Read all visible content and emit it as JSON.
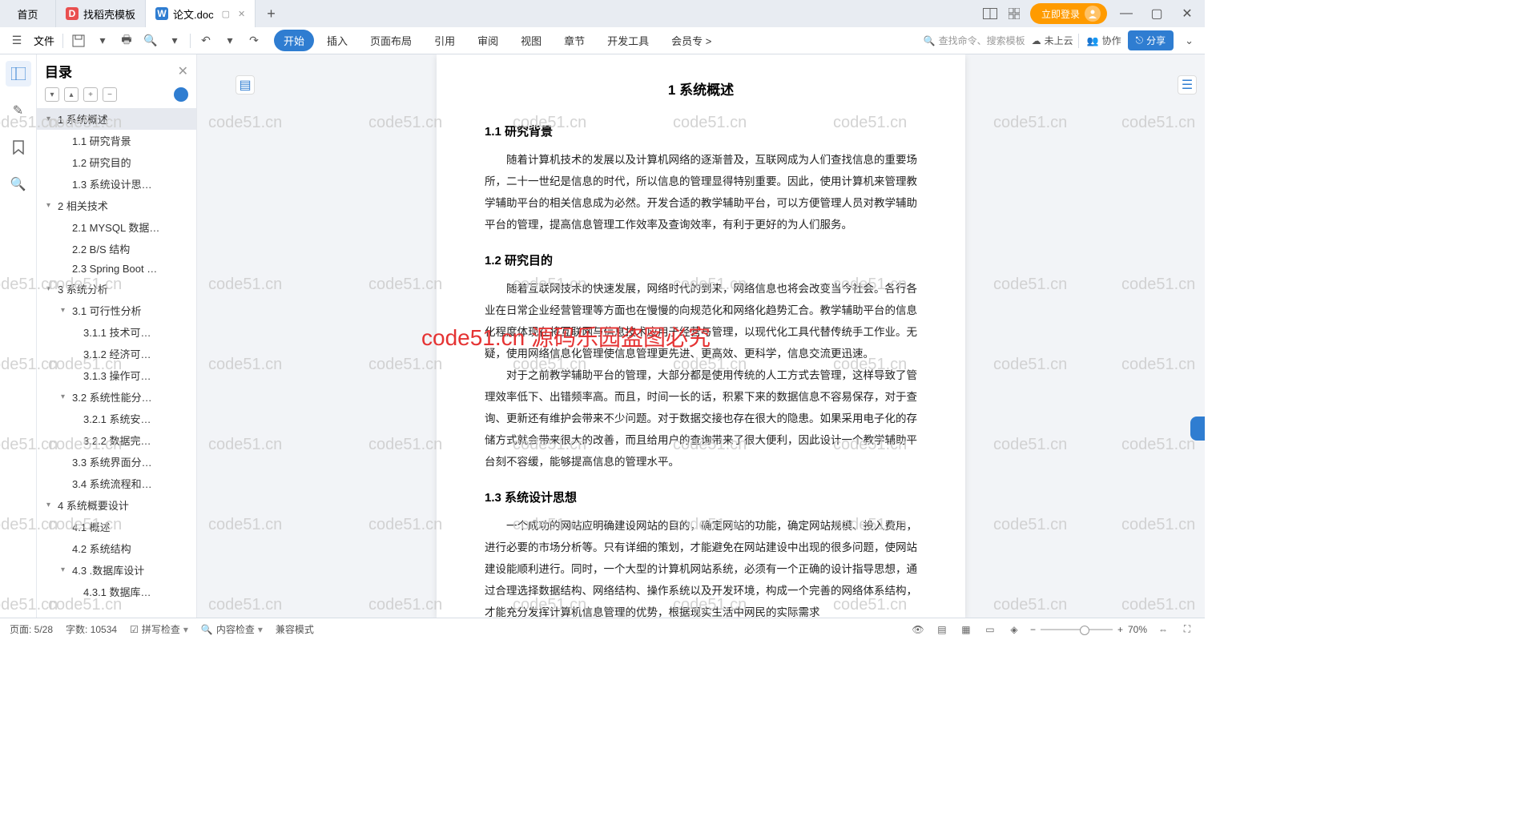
{
  "tabs": {
    "home": "首页",
    "t1": "找稻壳模板",
    "t2": "论文.doc"
  },
  "login": "立即登录",
  "ribbon": {
    "file": "文件",
    "tabs": [
      "开始",
      "插入",
      "页面布局",
      "引用",
      "审阅",
      "视图",
      "章节",
      "开发工具",
      "会员专"
    ],
    "search": "查找命令、搜索模板",
    "cloud": "未上云",
    "collab": "协作",
    "share": "分享"
  },
  "outline": {
    "title": "目录",
    "items": [
      {
        "lvl": 1,
        "txt": "1 系统概述",
        "sel": true,
        "chev": "▾"
      },
      {
        "lvl": 2,
        "txt": "1.1 研究背景"
      },
      {
        "lvl": 2,
        "txt": "1.2 研究目的"
      },
      {
        "lvl": 2,
        "txt": "1.3 系统设计思…"
      },
      {
        "lvl": 1,
        "txt": "2 相关技术",
        "chev": "▾"
      },
      {
        "lvl": 2,
        "txt": "2.1 MYSQL 数据…"
      },
      {
        "lvl": 2,
        "txt": "2.2 B/S 结构"
      },
      {
        "lvl": 2,
        "txt": "2.3 Spring Boot …"
      },
      {
        "lvl": 1,
        "txt": "3 系统分析",
        "chev": "▾"
      },
      {
        "lvl": 2,
        "txt": "3.1 可行性分析",
        "chev": "▾"
      },
      {
        "lvl": 3,
        "txt": "3.1.1 技术可…"
      },
      {
        "lvl": 3,
        "txt": "3.1.2 经济可…"
      },
      {
        "lvl": 3,
        "txt": "3.1.3 操作可…"
      },
      {
        "lvl": 2,
        "txt": "3.2 系统性能分…",
        "chev": "▾"
      },
      {
        "lvl": 3,
        "txt": "3.2.1 系统安…"
      },
      {
        "lvl": 3,
        "txt": "3.2.2 数据完…"
      },
      {
        "lvl": 2,
        "txt": "3.3 系统界面分…"
      },
      {
        "lvl": 2,
        "txt": "3.4 系统流程和…"
      },
      {
        "lvl": 1,
        "txt": "4 系统概要设计",
        "chev": "▾"
      },
      {
        "lvl": 2,
        "txt": "4.1 概述"
      },
      {
        "lvl": 2,
        "txt": "4.2 系统结构"
      },
      {
        "lvl": 2,
        "txt": "4.3 .数据库设计",
        "chev": "▾"
      },
      {
        "lvl": 3,
        "txt": "4.3.1 数据库…"
      }
    ]
  },
  "doc": {
    "h1": "1 系统概述",
    "s11": "1.1 研究背景",
    "p11": "随着计算机技术的发展以及计算机网络的逐渐普及，互联网成为人们查找信息的重要场所，二十一世纪是信息的时代，所以信息的管理显得特别重要。因此，使用计算机来管理教学辅助平台的相关信息成为必然。开发合适的教学辅助平台，可以方便管理人员对教学辅助平台的管理，提高信息管理工作效率及查询效率，有利于更好的为人们服务。",
    "s12": "1.2 研究目的",
    "p12a": "随着互联网技术的快速发展，网络时代的到来，网络信息也将会改变当今社会。各行各业在日常企业经营管理等方面也在慢慢的向规范化和网络化趋势汇合。教学辅助平台的信息化程度体现在将互联网与信息技术应用于经营与管理，以现代化工具代替传统手工作业。无疑，使用网络信息化管理使信息管理更先进、更高效、更科学，信息交流更迅速。",
    "p12b": "对于之前教学辅助平台的管理，大部分都是使用传统的人工方式去管理，这样导致了管理效率低下、出错频率高。而且，时间一长的话，积累下来的数据信息不容易保存，对于查询、更新还有维护会带来不少问题。对于数据交接也存在很大的隐患。如果采用电子化的存储方式就会带来很大的改善，而且给用户的查询带来了很大便利，因此设计一个教学辅助平台刻不容缓，能够提高信息的管理水平。",
    "s13": "1.3 系统设计思想",
    "p13": "一个成功的网站应明确建设网站的目的，确定网站的功能，确定网站规模、投入费用，进行必要的市场分析等。只有详细的策划，才能避免在网站建设中出现的很多问题，使网站建设能顺利进行。同时，一个大型的计算机网站系统，必须有一个正确的设计指导思想，通过合理选择数据结构、网络结构、操作系统以及开发环境，构成一个完善的网络体系结构，才能充分发挥计算机信息管理的优势，根据现实生活中网民的实际需求"
  },
  "watermark": "code51.cn",
  "wm_red": "code51.cn 源码乐园盗图必究",
  "status": {
    "page": "页面: 5/28",
    "words": "字数: 10534",
    "spell": "拼写检查",
    "content": "内容检查",
    "compat": "兼容模式",
    "zoom": "70%"
  }
}
